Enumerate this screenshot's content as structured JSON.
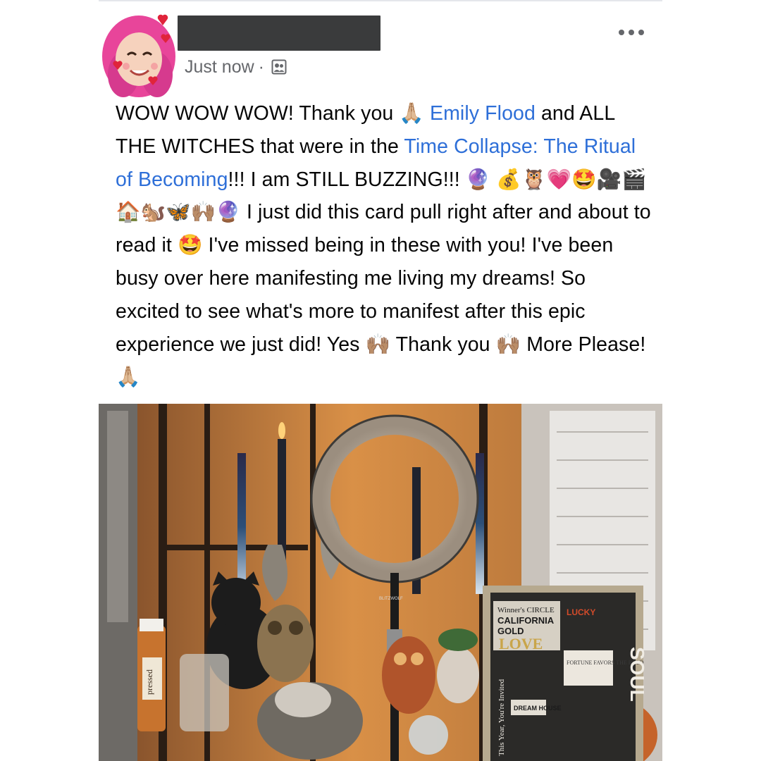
{
  "post": {
    "timestamp": "Just now",
    "separator": "·",
    "audience_icon": "friends-audience-icon",
    "more_icon": "more-options-icon",
    "text": {
      "p1": "WOW WOW WOW! Thank you ",
      "e_pray": "🙏🏼",
      "link1": "Emily Flood",
      "p2": " and ALL THE WITCHES that were in the ",
      "link2": "Time Collapse: The Ritual of Becoming",
      "p3": "!!! I am STILL BUZZING!!! ",
      "e_row": "🔮 💰🦉💗🤩🎥🎬🏠🐿️🦋🙌🏽🔮",
      "p4": " I just did this card pull right after and about to read it ",
      "e_starstruck": "🤩",
      "p5": " I've missed being in these with you! I've been busy over here manifesting me living my dreams! So excited to see what's more to manifest after this epic experience we just did! Yes ",
      "e_raise1": "🙌🏽",
      "p6": " Thank you ",
      "e_raise2": "🙌🏽",
      "p7": " More Please! ",
      "e_pray2": "🙏🏼"
    },
    "photo": {
      "board_lines": [
        "Winner's CIRCLE",
        "CALIFORNIA",
        "GOLD",
        "LOVE",
        "LUCKY",
        "FORTUNE FAVORS THE BOLD",
        "DREAM HOUSE",
        "SOUL",
        "This Year, You're Invited"
      ],
      "jar_label": "pressed",
      "ring_light_brand": "BLITZWOLF"
    }
  },
  "colors": {
    "link": "#2e6fd8",
    "meta": "#65676b",
    "name_redacted": "#3a3b3c"
  }
}
